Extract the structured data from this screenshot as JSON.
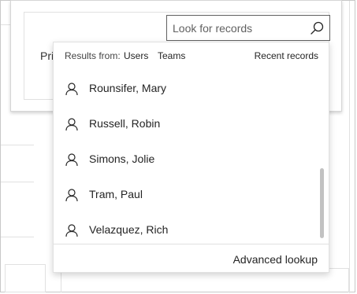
{
  "card": {
    "label_partial": "Pri"
  },
  "search": {
    "placeholder": "Look for records",
    "value": ""
  },
  "dropdown": {
    "results_from_label": "Results from:",
    "filters": [
      "Users",
      "Teams"
    ],
    "recent_records": "Recent records",
    "items": [
      {
        "label": "Rounsifer, Mary",
        "icon": "user-icon"
      },
      {
        "label": "Russell, Robin",
        "icon": "user-icon"
      },
      {
        "label": "Simons, Jolie",
        "icon": "user-icon"
      },
      {
        "label": "Tram, Paul",
        "icon": "user-icon"
      },
      {
        "label": "Velazquez, Rich",
        "icon": "user-icon"
      }
    ],
    "advanced_lookup": "Advanced lookup"
  },
  "colors": {
    "border": "#616161",
    "divider": "#e1e1e1",
    "scrollbar": "#c2c2c2",
    "text": "#242424"
  }
}
